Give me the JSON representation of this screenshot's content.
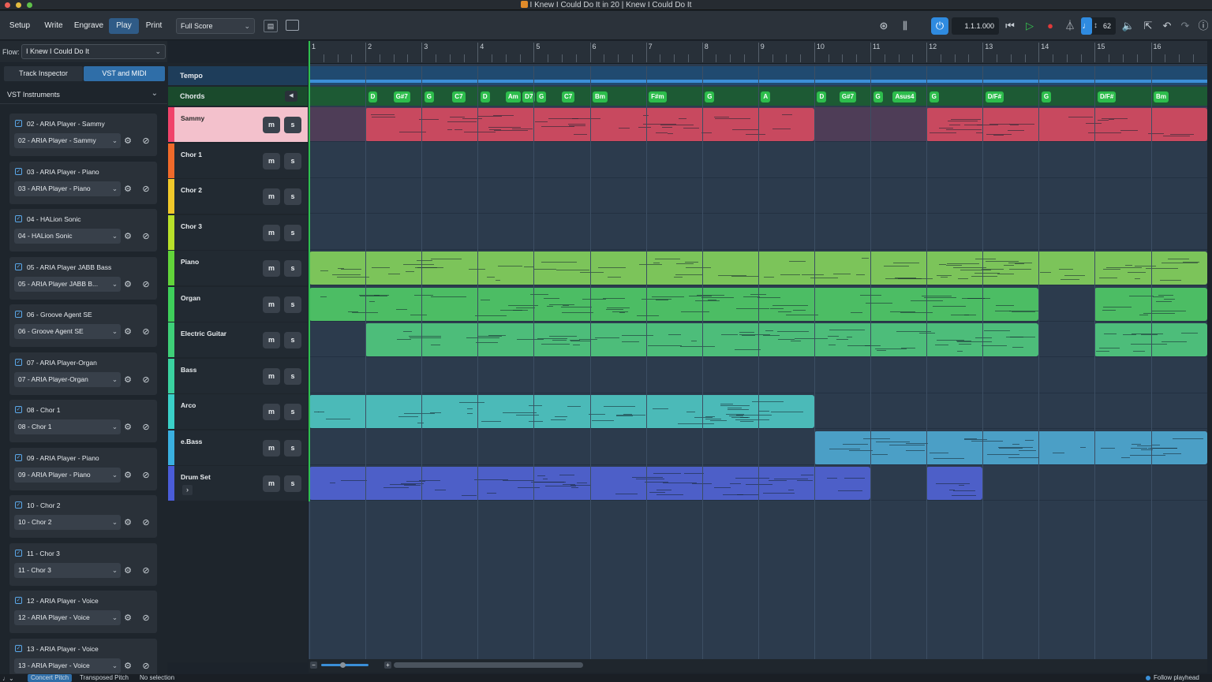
{
  "window": {
    "title": "I Knew I Could Do It in 20 | Knew I Could Do It"
  },
  "toolbar": {
    "modes": [
      "Setup",
      "Write",
      "Engrave",
      "Play",
      "Print"
    ],
    "active_mode": "Play",
    "layout_select": "Full Score",
    "timecode": "1.1.1.000",
    "tempo_value": "62",
    "icons": [
      "page-view-icon",
      "galley-view-icon",
      "video-icon",
      "mixer-icon",
      "power-icon",
      "rewind-icon",
      "play-icon",
      "record-icon",
      "metronome-icon",
      "click-icon",
      "volume-icon",
      "export-icon",
      "undo-icon",
      "redo-icon",
      "help-icon"
    ]
  },
  "flow": {
    "label": "Flow:",
    "value": "I Knew I Could Do It"
  },
  "sidepanel": {
    "tabs": [
      "Track Inspector",
      "VST and MIDI"
    ],
    "active_tab": "VST and MIDI",
    "section": "VST Instruments",
    "instruments": [
      {
        "name": "02 - ARIA Player - Sammy",
        "select": "02 - ARIA Player - Sammy"
      },
      {
        "name": "03 - ARIA Player - Piano",
        "select": "03 - ARIA Player - Piano"
      },
      {
        "name": "04 - HALion Sonic",
        "select": "04 - HALion Sonic"
      },
      {
        "name": "05 - ARIA Player JABB Bass",
        "select": "05 - ARIA Player JABB B..."
      },
      {
        "name": "06 - Groove Agent SE",
        "select": "06 - Groove Agent SE"
      },
      {
        "name": "07 - ARIA Player-Organ",
        "select": "07 - ARIA Player-Organ"
      },
      {
        "name": "08 - Chor 1",
        "select": "08 - Chor 1"
      },
      {
        "name": "09 - ARIA Player - Piano",
        "select": "09 - ARIA Player - Piano"
      },
      {
        "name": "10 - Chor 2",
        "select": "10 - Chor 2"
      },
      {
        "name": "11 - Chor 3",
        "select": "11 - Chor 3"
      },
      {
        "name": "12 - ARIA Player - Voice",
        "select": "12 - ARIA Player - Voice"
      },
      {
        "name": "13 - ARIA Player - Voice",
        "select": "13 - ARIA Player - Voice"
      }
    ]
  },
  "global_tracks": {
    "tempo": "Tempo",
    "chords": "Chords"
  },
  "ms_labels": {
    "mute": "m",
    "solo": "s"
  },
  "bars": [
    "1",
    "2",
    "3",
    "4",
    "5",
    "6",
    "7",
    "8",
    "9",
    "10",
    "11",
    "12",
    "13",
    "14",
    "15",
    "16"
  ],
  "chords": [
    {
      "label": "D",
      "bar": 2.05
    },
    {
      "label": "G#7",
      "bar": 2.5
    },
    {
      "label": "G",
      "bar": 3.05
    },
    {
      "label": "C7",
      "bar": 3.55
    },
    {
      "label": "D",
      "bar": 4.05
    },
    {
      "label": "Am",
      "bar": 4.5
    },
    {
      "label": "D7",
      "bar": 4.8
    },
    {
      "label": "G",
      "bar": 5.05
    },
    {
      "label": "C7",
      "bar": 5.5
    },
    {
      "label": "Bm",
      "bar": 6.05
    },
    {
      "label": "F#m",
      "bar": 7.05
    },
    {
      "label": "G",
      "bar": 8.05
    },
    {
      "label": "A",
      "bar": 9.05
    },
    {
      "label": "D",
      "bar": 10.05
    },
    {
      "label": "G#7",
      "bar": 10.45
    },
    {
      "label": "G",
      "bar": 11.05
    },
    {
      "label": "Asus4",
      "bar": 11.4
    },
    {
      "label": "G",
      "bar": 12.05
    },
    {
      "label": "D/F#",
      "bar": 13.05
    },
    {
      "label": "G",
      "bar": 14.05
    },
    {
      "label": "D/F#",
      "bar": 15.05
    },
    {
      "label": "Bm",
      "bar": 16.05
    }
  ],
  "tracks": [
    {
      "name": "Sammy",
      "color": "#f0436a",
      "regions": [
        {
          "start": 2,
          "end": 10
        },
        {
          "start": 12,
          "end": 17
        }
      ],
      "region_color": "#c8495f",
      "selected": true
    },
    {
      "name": "Chor 1",
      "color": "#f06a2a",
      "regions": []
    },
    {
      "name": "Chor 2",
      "color": "#f0c82a",
      "regions": []
    },
    {
      "name": "Chor 3",
      "color": "#b8e02a",
      "regions": []
    },
    {
      "name": "Piano",
      "color": "#62d43a",
      "regions": [
        {
          "start": 1,
          "end": 17
        }
      ],
      "region_color": "#7cc45a"
    },
    {
      "name": "Organ",
      "color": "#3ecf5a",
      "regions": [
        {
          "start": 1,
          "end": 14
        },
        {
          "start": 15,
          "end": 17
        }
      ],
      "region_color": "#4cbd64"
    },
    {
      "name": "Electric Guitar",
      "color": "#3ed078",
      "regions": [
        {
          "start": 2,
          "end": 14
        },
        {
          "start": 15,
          "end": 17
        }
      ],
      "region_color": "#4dbd7a"
    },
    {
      "name": "Bass",
      "color": "#3ad2a0",
      "regions": []
    },
    {
      "name": "Arco",
      "color": "#3ad0c8",
      "regions": [
        {
          "start": 1,
          "end": 10
        }
      ],
      "region_color": "#4bbab8"
    },
    {
      "name": "e.Bass",
      "color": "#3ab0e0",
      "regions": [
        {
          "start": 10,
          "end": 17
        }
      ],
      "region_color": "#4b9fc6"
    },
    {
      "name": "Drum Set",
      "color": "#4a5cd8",
      "regions": [
        {
          "start": 1,
          "end": 11
        },
        {
          "start": 12,
          "end": 13
        }
      ],
      "region_color": "#4d5fc8",
      "expand": true
    }
  ],
  "statusbar": {
    "concert": "Concert Pitch",
    "transposed": "Transposed Pitch",
    "selection": "No selection",
    "follow": "Follow playhead"
  }
}
